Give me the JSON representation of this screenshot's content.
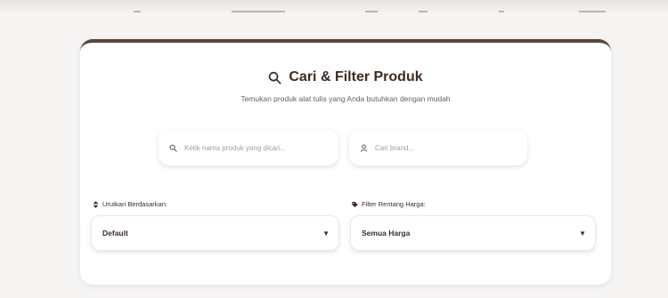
{
  "header": {
    "title": "Cari & Filter Produk",
    "subtitle": "Temukan produk alat tulis yang Anda butuhkan dengan mudah"
  },
  "search": {
    "product_placeholder": "Ketik nama produk yang dicari...",
    "brand_placeholder": "Cari brand..."
  },
  "sort": {
    "label": "Urutkan Berdasarkan:",
    "selected": "Default"
  },
  "price_filter": {
    "label": "Filter Rentang Harga:",
    "selected": "Semua Harga"
  },
  "icons": {
    "title": "search-icon",
    "product": "search-icon",
    "brand": "user-icon",
    "sort": "sort-icon",
    "price": "tag-icon"
  },
  "colors": {
    "accent": "#5b4638",
    "text": "#3b2d24",
    "placeholder": "#a79d96"
  }
}
